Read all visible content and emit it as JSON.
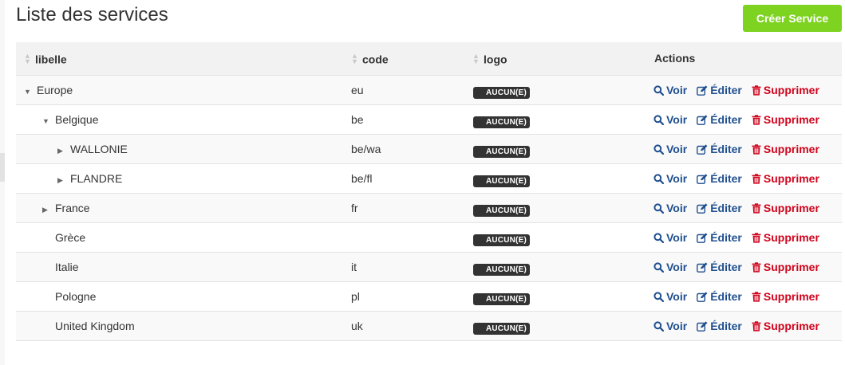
{
  "page": {
    "title": "Liste des services",
    "create_button": "Créer Service"
  },
  "table": {
    "headers": {
      "libelle": "libelle",
      "code": "code",
      "logo": "logo",
      "actions": "Actions"
    },
    "rows": [
      {
        "libelle": "Europe",
        "code": "eu",
        "logo": "AUCUN(E)",
        "level": 0,
        "toggle": "expanded"
      },
      {
        "libelle": "Belgique",
        "code": "be",
        "logo": "AUCUN(E)",
        "level": 1,
        "toggle": "expanded"
      },
      {
        "libelle": "WALLONIE",
        "code": "be/wa",
        "logo": "AUCUN(E)",
        "level": 2,
        "toggle": "collapsed"
      },
      {
        "libelle": "FLANDRE",
        "code": "be/fl",
        "logo": "AUCUN(E)",
        "level": 2,
        "toggle": "collapsed"
      },
      {
        "libelle": "France",
        "code": "fr",
        "logo": "AUCUN(E)",
        "level": 1,
        "toggle": "collapsed"
      },
      {
        "libelle": "Grèce",
        "code": "",
        "logo": "AUCUN(E)",
        "level": 1,
        "toggle": "none"
      },
      {
        "libelle": "Italie",
        "code": "it",
        "logo": "AUCUN(E)",
        "level": 1,
        "toggle": "none"
      },
      {
        "libelle": "Pologne",
        "code": "pl",
        "logo": "AUCUN(E)",
        "level": 1,
        "toggle": "none"
      },
      {
        "libelle": "United Kingdom",
        "code": "uk",
        "logo": "AUCUN(E)",
        "level": 1,
        "toggle": "none"
      }
    ],
    "actions": {
      "view": "Voir",
      "edit": "Éditer",
      "delete": "Supprimer"
    }
  },
  "icons": {
    "sort": "sort-icon",
    "expanded": "caret-down-icon",
    "collapsed": "caret-right-icon",
    "view": "search-icon",
    "edit": "edit-icon",
    "delete": "trash-icon"
  },
  "colors": {
    "create_button": "#7ed321",
    "link": "#1f4f8f",
    "danger": "#d0021b",
    "badge": "#333333"
  }
}
